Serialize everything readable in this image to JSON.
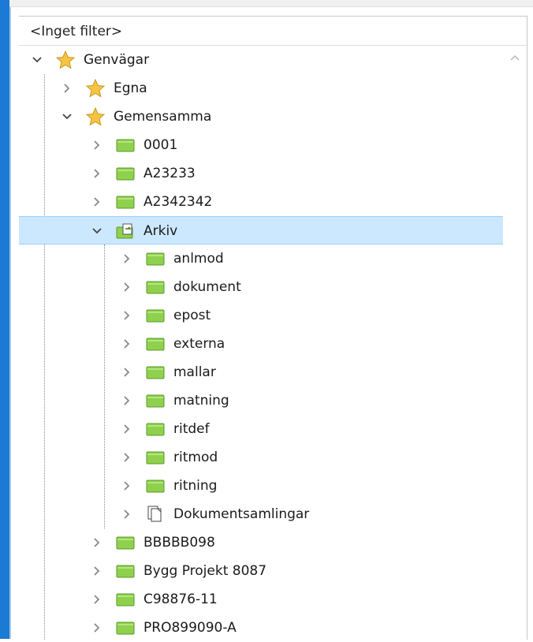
{
  "filter": {
    "text": "<Inget filter>"
  },
  "tree": {
    "genvagar": {
      "label": "Genvägar",
      "icon": "star-icon"
    },
    "egna": {
      "label": "Egna",
      "icon": "star-icon"
    },
    "gemensamma": {
      "label": "Gemensamma",
      "icon": "star-icon"
    },
    "items": [
      {
        "label": "0001",
        "icon": "folder-icon"
      },
      {
        "label": "A23233",
        "icon": "folder-icon"
      },
      {
        "label": "A2342342",
        "icon": "folder-icon"
      },
      {
        "label": "Arkiv",
        "icon": "shared-folder-icon",
        "selected": true
      },
      {
        "label": "anlmod",
        "icon": "folder-icon"
      },
      {
        "label": "dokument",
        "icon": "folder-icon"
      },
      {
        "label": "epost",
        "icon": "folder-icon"
      },
      {
        "label": "externa",
        "icon": "folder-icon"
      },
      {
        "label": "mallar",
        "icon": "folder-icon"
      },
      {
        "label": "matning",
        "icon": "folder-icon"
      },
      {
        "label": "ritdef",
        "icon": "folder-icon"
      },
      {
        "label": "ritmod",
        "icon": "folder-icon"
      },
      {
        "label": "ritning",
        "icon": "folder-icon"
      },
      {
        "label": "Dokumentsamlingar",
        "icon": "documents-icon"
      },
      {
        "label": "BBBBB098",
        "icon": "folder-icon"
      },
      {
        "label": "Bygg Projekt 8087",
        "icon": "folder-icon"
      },
      {
        "label": "C98876-11",
        "icon": "folder-icon"
      },
      {
        "label": "PRO899090-A",
        "icon": "folder-icon"
      }
    ]
  },
  "colors": {
    "selection": "#cce8ff",
    "folder": "#8fd14f",
    "star": "#f6c343",
    "accent": "#1a7ad4"
  }
}
